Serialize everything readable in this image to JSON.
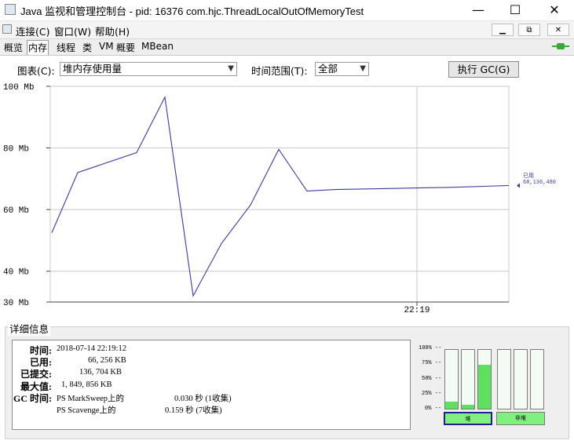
{
  "window": {
    "title": "Java 监视和管理控制台 - pid: 16376 com.hjc.ThreadLocalOutOfMemoryTest",
    "controls": {
      "minimize": "—",
      "maximize": "☐",
      "close": "✕"
    }
  },
  "menubar": {
    "items": [
      "连接(C)",
      "窗口(W)",
      "帮助(H)"
    ],
    "mdi_controls": [
      "▁",
      "⧉",
      "✕"
    ]
  },
  "tabs": {
    "items": [
      "概览",
      "内存",
      "线程",
      "类",
      "VM",
      "概要",
      "MBean"
    ],
    "active": "内存"
  },
  "controls": {
    "chart_label": "图表(C):",
    "chart_select_value": "堆内存使用量",
    "range_label": "时间范围(T):",
    "range_select_value": "全部",
    "gc_button": "执行 GC(G)"
  },
  "chart_data": {
    "type": "line",
    "ylim": [
      30,
      100
    ],
    "y_ticks": [
      "100 Mb",
      "80 Mb",
      "60 Mb",
      "40 Mb",
      "30 Mb"
    ],
    "x_tick_label": "22:19",
    "series": [
      {
        "name": "已用",
        "color": "#3b3b9b",
        "values": [
          52.5,
          72,
          78.5,
          96.5,
          32,
          49,
          61.5,
          79.5,
          66,
          66.5,
          67,
          67.2,
          67.8
        ]
      }
    ],
    "value_label": "68,136,480"
  },
  "details": {
    "title": "详细信息",
    "rows": [
      {
        "label": "时间:",
        "value": "2018-07-14 22:19:12"
      },
      {
        "label": "已用:",
        "value": "66, 256 KB"
      },
      {
        "label": "已提交:",
        "value": "136, 704 KB"
      },
      {
        "label": "最大值:",
        "value": "1, 849, 856 KB"
      }
    ],
    "gc_label": "GC 时间:",
    "gc_rows": [
      {
        "name": "PS MarkSweep上的",
        "value": "0.030 秒 (1收集)"
      },
      {
        "name": "PS Scavenge上的",
        "value": "0.159 秒 (7收集)"
      }
    ]
  },
  "pools": {
    "pct_labels": [
      "100% --",
      "75% --",
      "50% --",
      "25% --",
      "0% --"
    ],
    "heap_fill": [
      0.12,
      0.07,
      0.75
    ],
    "nonheap_fill": [
      0,
      0,
      0
    ],
    "heap_button": "堆",
    "nonheap_button": "非堆"
  }
}
